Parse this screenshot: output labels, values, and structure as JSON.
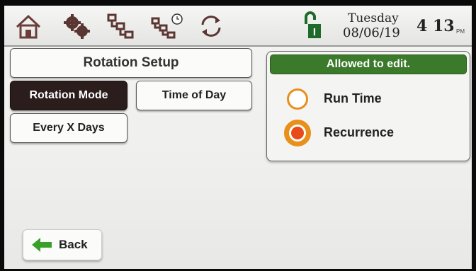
{
  "topbar": {
    "icons": [
      "home-icon",
      "settings-gears-icon",
      "flowchart-icon",
      "scheduled-flowchart-icon",
      "sync-icon"
    ],
    "status_icon": "ignition-lock-icon",
    "status_letter": "I",
    "day": "Tuesday",
    "date": "08/06/19",
    "time": "4 13",
    "ampm": "PM"
  },
  "setup": {
    "title": "Rotation Setup",
    "buttons": [
      {
        "label": "Rotation Mode",
        "selected": true
      },
      {
        "label": "Time of Day",
        "selected": false
      },
      {
        "label": "Every X Days",
        "selected": false
      }
    ]
  },
  "panel": {
    "header": "Allowed to edit.",
    "options": [
      {
        "label": "Run Time",
        "selected": false
      },
      {
        "label": "Recurrence",
        "selected": true
      }
    ]
  },
  "back": {
    "label": "Back"
  },
  "colors": {
    "accent": "#e8901a",
    "header_green": "#3a7a2a",
    "selected_btn": "#2a1d1c"
  }
}
